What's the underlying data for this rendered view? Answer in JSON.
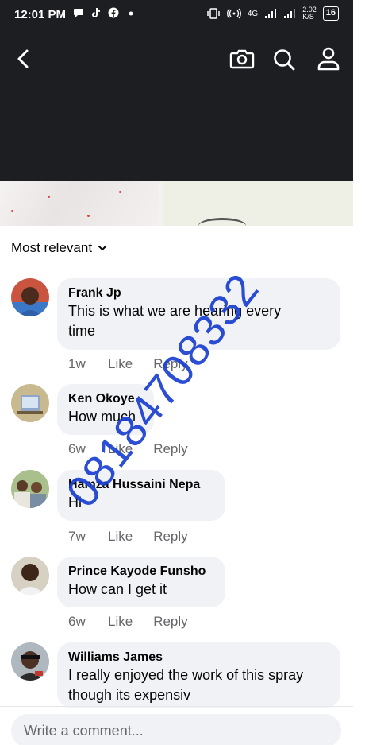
{
  "status_bar": {
    "time": "12:01 PM",
    "left_icons": [
      "chat-bubble-icon",
      "tiktok-icon",
      "facebook-icon",
      "dot-icon"
    ],
    "network": "4G",
    "speed": "2.02",
    "speed_unit": "K/S",
    "battery": "16"
  },
  "nav": {
    "icons": [
      "back-icon",
      "camera-icon",
      "search-icon",
      "profile-icon"
    ]
  },
  "filter": {
    "label": "Most relevant"
  },
  "comments": [
    {
      "author": "Frank Jp",
      "text_lines": [
        "This is what we are hearing every",
        "time"
      ],
      "time": "1w",
      "like": "Like",
      "reply": "Reply"
    },
    {
      "author": "Ken Okoye",
      "text_lines": [
        "How much"
      ],
      "time": "6w",
      "like": "Like",
      "reply": "Reply"
    },
    {
      "author": "Hamza Hussaini Nepa",
      "text_lines": [
        "Hi"
      ],
      "time": "7w",
      "like": "Like",
      "reply": "Reply"
    },
    {
      "author": "Prince Kayode Funsho",
      "text_lines": [
        "How can I get it"
      ],
      "time": "6w",
      "like": "Like",
      "reply": "Reply"
    },
    {
      "author": "Williams James",
      "text_lines": [
        "I really enjoyed the work of this spray",
        "though its expensiv"
      ]
    }
  ],
  "composer": {
    "placeholder": "Write a comment..."
  },
  "watermark": {
    "text": "08184708332",
    "color": "#1a3fd1"
  },
  "colors": {
    "header_bg": "#1c1e21",
    "bubble_bg": "#f0f2f5",
    "meta_text": "#65676b"
  }
}
